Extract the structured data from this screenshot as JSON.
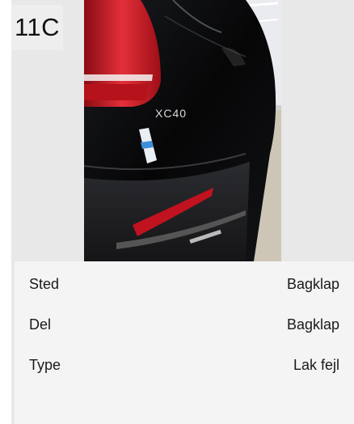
{
  "badge": {
    "label": "11C"
  },
  "photo": {
    "subject": "car-rear-photo",
    "emblem_text": "XC40"
  },
  "details": {
    "rows": [
      {
        "key": "Sted",
        "value": "Bagklap"
      },
      {
        "key": "Del",
        "value": "Bagklap"
      },
      {
        "key": "Type",
        "value": "Lak fejl"
      }
    ]
  },
  "colors": {
    "card_bg": "#e8e8e8",
    "details_bg": "#f4f4f4",
    "car_body": "#0b0b0d",
    "tail_light": "#c1121f"
  }
}
